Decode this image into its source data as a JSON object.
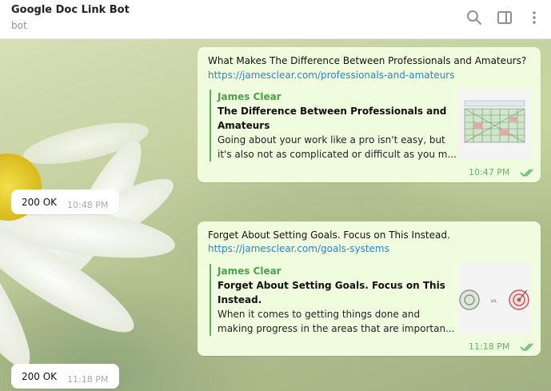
{
  "header": {
    "title": "Google Doc Link Bot",
    "subtitle": "bot",
    "icons": [
      "search-icon",
      "sidebar-toggle-icon",
      "more-vertical-icon"
    ]
  },
  "messages": [
    {
      "text": "What Makes The Difference Between Professionals and Amateurs?",
      "link": "https://jamesclear.com/professionals-and-amateurs",
      "preview": {
        "site": "James Clear",
        "title": "The Difference Between Professionals and Amateurs",
        "description": "Going about your work like a pro isn't easy, but it's also not as complicated or difficult as you m..."
      },
      "time": "10:47 PM"
    },
    {
      "reply": "200 OK",
      "time": "10:48 PM"
    },
    {
      "text": "Forget About Setting Goals. Focus on This Instead.",
      "link": "https://jamesclear.com/goals-systems",
      "preview": {
        "site": "James Clear",
        "title": "Forget About Setting Goals. Focus on This Instead.",
        "description": "When it comes to getting things done and making progress in the areas that are importan...",
        "thumb_label": "vs."
      },
      "time": "11:18 PM"
    },
    {
      "reply": "200 OK",
      "time": "11:18 PM"
    }
  ],
  "colors": {
    "outgoing_bubble": "#effdde",
    "link": "#2d84c5",
    "site_name": "#4ca04c",
    "read_checks": "#63b46a"
  }
}
